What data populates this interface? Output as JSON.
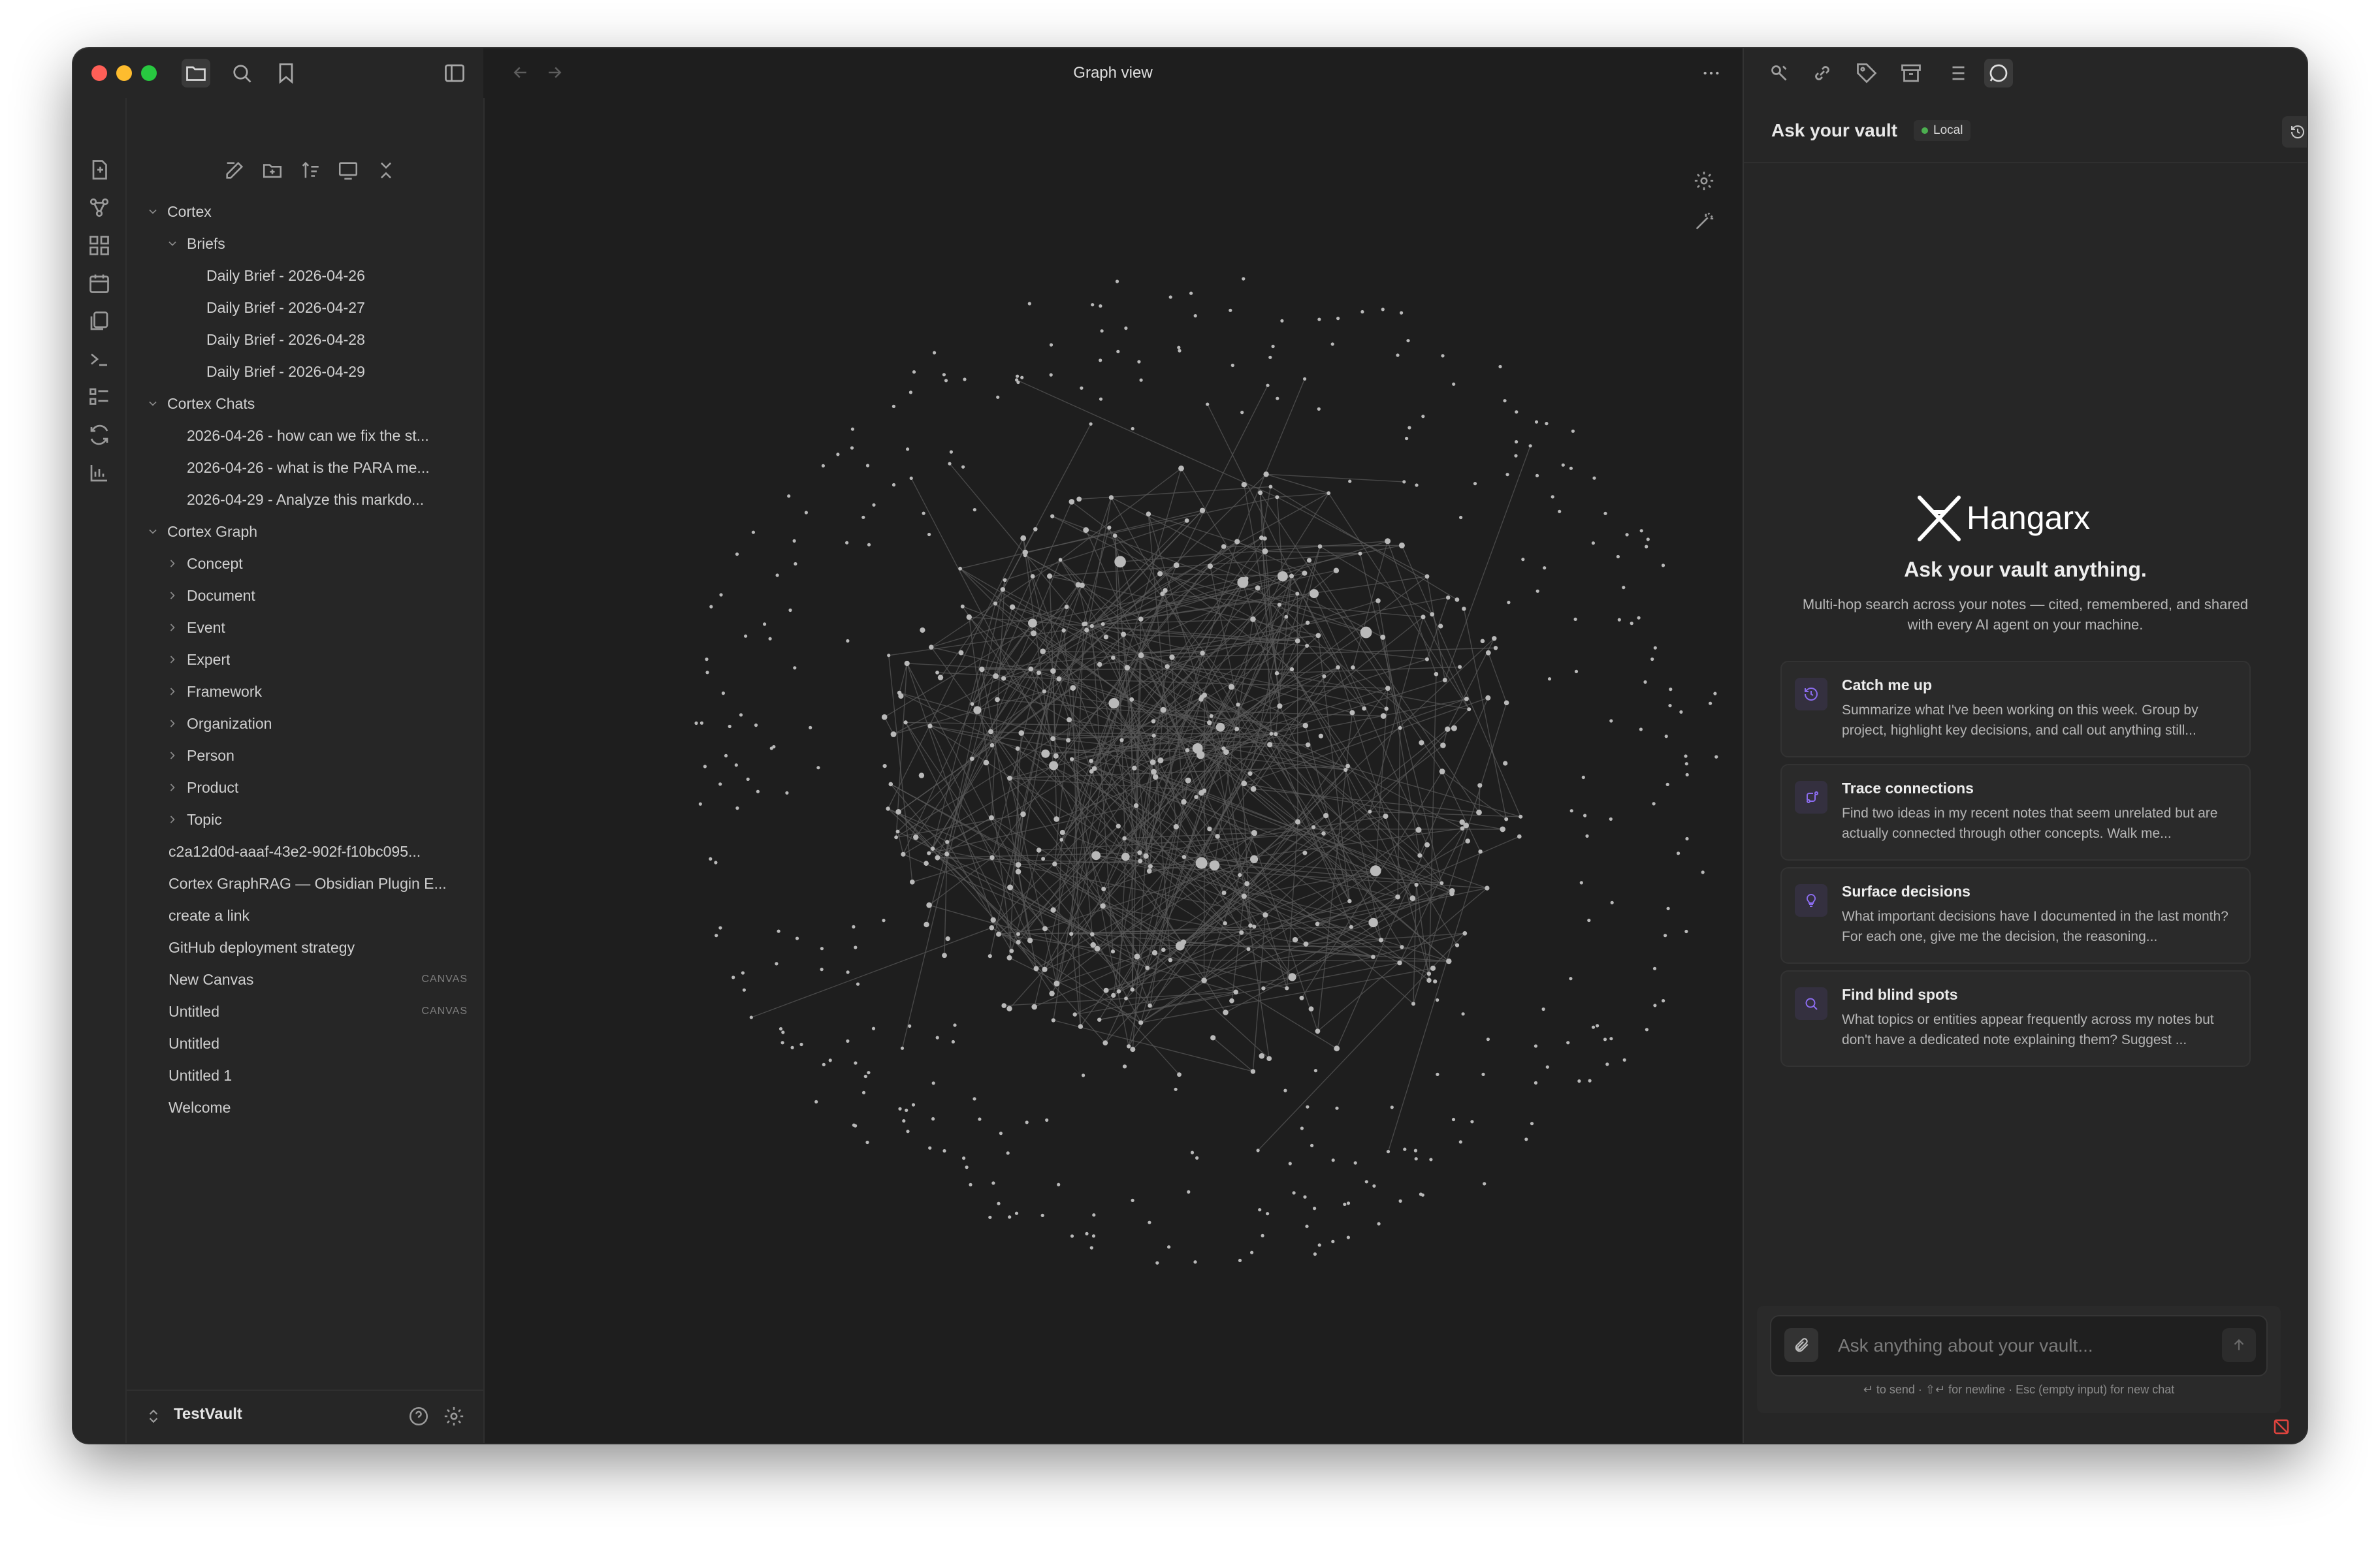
{
  "window": {
    "title": "Graph view"
  },
  "sidebar": {
    "tree": [
      {
        "label": "Cortex",
        "depth": 0,
        "type": "folder",
        "open": true
      },
      {
        "label": "Briefs",
        "depth": 1,
        "type": "folder",
        "open": true
      },
      {
        "label": "Daily Brief - 2026-04-26",
        "depth": 2,
        "type": "file"
      },
      {
        "label": "Daily Brief - 2026-04-27",
        "depth": 2,
        "type": "file"
      },
      {
        "label": "Daily Brief - 2026-04-28",
        "depth": 2,
        "type": "file"
      },
      {
        "label": "Daily Brief - 2026-04-29",
        "depth": 2,
        "type": "file"
      },
      {
        "label": "Cortex Chats",
        "depth": 0,
        "type": "folder",
        "open": true
      },
      {
        "label": "2026-04-26 - how can we fix the st...",
        "depth": 1,
        "type": "file"
      },
      {
        "label": "2026-04-26 - what is the PARA me...",
        "depth": 1,
        "type": "file"
      },
      {
        "label": "2026-04-29 - Analyze this markdo...",
        "depth": 1,
        "type": "file"
      },
      {
        "label": "Cortex Graph",
        "depth": 0,
        "type": "folder",
        "open": true
      },
      {
        "label": "Concept",
        "depth": 1,
        "type": "folder",
        "open": false
      },
      {
        "label": "Document",
        "depth": 1,
        "type": "folder",
        "open": false
      },
      {
        "label": "Event",
        "depth": 1,
        "type": "folder",
        "open": false
      },
      {
        "label": "Expert",
        "depth": 1,
        "type": "folder",
        "open": false
      },
      {
        "label": "Framework",
        "depth": 1,
        "type": "folder",
        "open": false
      },
      {
        "label": "Organization",
        "depth": 1,
        "type": "folder",
        "open": false
      },
      {
        "label": "Person",
        "depth": 1,
        "type": "folder",
        "open": false
      },
      {
        "label": "Product",
        "depth": 1,
        "type": "folder",
        "open": false
      },
      {
        "label": "Topic",
        "depth": 1,
        "type": "folder",
        "open": false
      },
      {
        "label": "c2a12d0d-aaaf-43e2-902f-f10bc095...",
        "depth": 0,
        "type": "file"
      },
      {
        "label": "Cortex GraphRAG — Obsidian Plugin E...",
        "depth": 0,
        "type": "file"
      },
      {
        "label": "create a link",
        "depth": 0,
        "type": "file"
      },
      {
        "label": "GitHub deployment strategy",
        "depth": 0,
        "type": "file"
      },
      {
        "label": "New Canvas",
        "depth": 0,
        "type": "file",
        "tag": "CANVAS"
      },
      {
        "label": "Untitled",
        "depth": 0,
        "type": "file",
        "tag": "CANVAS"
      },
      {
        "label": "Untitled",
        "depth": 0,
        "type": "file"
      },
      {
        "label": "Untitled 1",
        "depth": 0,
        "type": "file"
      },
      {
        "label": "Welcome",
        "depth": 0,
        "type": "file"
      }
    ],
    "vault_name": "TestVault"
  },
  "chat": {
    "title": "Ask your vault",
    "badge": "Local",
    "brand": "Hangarx",
    "hero_title": "Ask your vault anything.",
    "hero_subtitle": "Multi-hop search across your notes — cited, remembered, and shared with every AI agent on your machine.",
    "suggestions": [
      {
        "icon": "history-icon",
        "title": "Catch me up",
        "desc": "Summarize what I've been working on this week. Group by project, highlight key decisions, and call out anything still..."
      },
      {
        "icon": "route-icon",
        "title": "Trace connections",
        "desc": "Find two ideas in my recent notes that seem unrelated but are actually connected through other concepts. Walk me..."
      },
      {
        "icon": "lightbulb-icon",
        "title": "Surface decisions",
        "desc": "What important decisions have I documented in the last month? For each one, give me the decision, the reasoning..."
      },
      {
        "icon": "search-icon",
        "title": "Find blind spots",
        "desc": "What topics or entities appear frequently across my notes but don't have a dedicated note explaining them? Suggest ..."
      }
    ],
    "input_placeholder": "Ask anything about your vault...",
    "hint": "↵ to send · ⇧↵ for newline · Esc (empty input) for new chat"
  },
  "colors": {
    "accent": "#8b6cef",
    "node": "#b9b9b9",
    "edge": "#5a5a5a",
    "background": "#1e1e1e"
  }
}
